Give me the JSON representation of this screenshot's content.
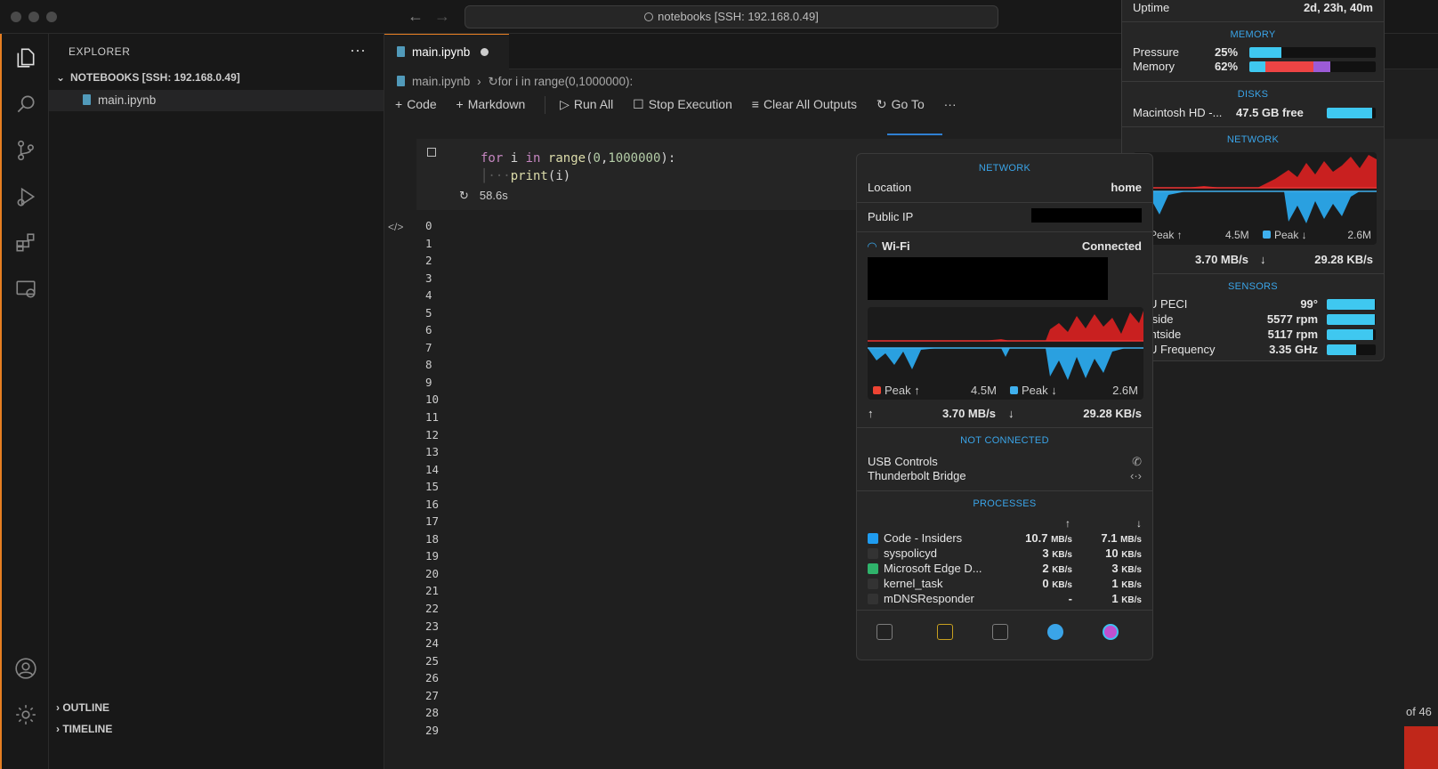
{
  "titlebar": {
    "search": "notebooks [SSH: 192.168.0.49]"
  },
  "sidebar": {
    "title": "EXPLORER",
    "folder": "NOTEBOOKS [SSH: 192.168.0.49]",
    "file": "main.ipynb",
    "outline": "OUTLINE",
    "timeline": "TIMELINE"
  },
  "editor": {
    "tab": "main.ipynb",
    "breadcrumb_file": "main.ipynb",
    "breadcrumb_cell": "for i in range(0,1000000):",
    "toolbar": {
      "code": "Code",
      "markdown": "Markdown",
      "run_all": "Run All",
      "stop": "Stop Execution",
      "clear": "Clear All Outputs",
      "goto": "Go To"
    },
    "code": {
      "kw_for": "for",
      "var": "i",
      "kw_in": "in",
      "fn_range": "range",
      "arg0": "0",
      "arg1": "1000000",
      "fn_print": "print",
      "arg_print": "i"
    },
    "exec_time": "58.6s",
    "output": [
      "0",
      "1",
      "2",
      "3",
      "4",
      "5",
      "6",
      "7",
      "8",
      "9",
      "10",
      "11",
      "12",
      "13",
      "14",
      "15",
      "16",
      "17",
      "18",
      "19",
      "20",
      "21",
      "22",
      "23",
      "24",
      "25",
      "26",
      "27",
      "28",
      "29"
    ]
  },
  "stats_main": {
    "uptime_label": "Uptime",
    "uptime_value": "2d, 23h, 40m",
    "memory_header": "MEMORY",
    "pressure_label": "Pressure",
    "pressure_value": "25%",
    "pressure_fill": 0.25,
    "memory_label": "Memory",
    "memory_value": "62%",
    "memory_fill": 0.62,
    "disks_header": "DISKS",
    "disk_label": "Macintosh HD -...",
    "disk_value": "47.5 GB free",
    "disk_fill": 0.93,
    "network_header": "NETWORK",
    "peak_up_label": "Peak ↑",
    "peak_up_value": "4.5M",
    "peak_down_label": "Peak ↓",
    "peak_down_value": "2.6M",
    "rate_up": "3.70 MB/s",
    "rate_down": "29.28 KB/s",
    "sensors_header": "SENSORS",
    "sensors": [
      {
        "label": "CPU PECI",
        "value": "99°",
        "fill": 0.99
      },
      {
        "label": "Leftside",
        "value": "5577 rpm",
        "fill": 0.98
      },
      {
        "label": "Rightside",
        "value": "5117 rpm",
        "fill": 0.95
      },
      {
        "label": "CPU Frequency",
        "value": "3.35 GHz",
        "fill": 0.6
      }
    ]
  },
  "network_panel": {
    "header": "NETWORK",
    "location_label": "Location",
    "location_value": "home",
    "public_ip_label": "Public IP",
    "wifi_label": "Wi-Fi",
    "wifi_status": "Connected",
    "peak_up_label": "Peak ↑",
    "peak_up_value": "4.5M",
    "peak_down_label": "Peak ↓",
    "peak_down_value": "2.6M",
    "rate_up": "3.70 MB/s",
    "rate_down": "29.28 KB/s",
    "not_connected_header": "NOT CONNECTED",
    "usb_label": "USB Controls",
    "thunderbolt_label": "Thunderbolt Bridge",
    "processes_header": "PROCESSES",
    "processes": [
      {
        "name": "Code - Insiders",
        "up": "10.7",
        "up_unit": "MB/s",
        "down": "7.1",
        "down_unit": "MB/s",
        "color": "#1f9cf0"
      },
      {
        "name": "syspolicyd",
        "up": "3",
        "up_unit": "KB/s",
        "down": "10",
        "down_unit": "KB/s",
        "color": "#333333"
      },
      {
        "name": "Microsoft Edge D...",
        "up": "2",
        "up_unit": "KB/s",
        "down": "3",
        "down_unit": "KB/s",
        "color": "#2fb36b"
      },
      {
        "name": "kernel_task",
        "up": "0",
        "up_unit": "KB/s",
        "down": "1",
        "down_unit": "KB/s",
        "color": "#333333"
      },
      {
        "name": "mDNSResponder",
        "up": "-",
        "up_unit": "",
        "down": "1",
        "down_unit": "KB/s",
        "color": "#333333"
      }
    ]
  },
  "right_edge": {
    "text": "of 46"
  }
}
